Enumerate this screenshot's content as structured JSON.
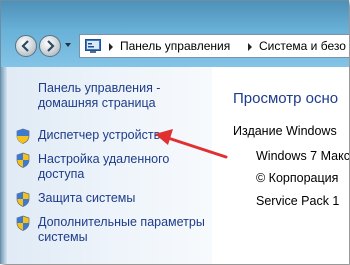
{
  "breadcrumb": [
    "Панель управления",
    "Система и безо"
  ],
  "sidebar": {
    "home_link": [
      "Панель управления -",
      "домашняя страница"
    ],
    "items": [
      {
        "label_lines": [
          "Диспетчер устройств"
        ],
        "icon": "shield-icon"
      },
      {
        "label_lines": [
          "Настройка удаленного",
          "доступа"
        ],
        "icon": "shield-icon"
      },
      {
        "label_lines": [
          "Защита системы"
        ],
        "icon": "shield-icon"
      },
      {
        "label_lines": [
          "Дополнительные параметры",
          "системы"
        ],
        "icon": "shield-icon"
      }
    ]
  },
  "main": {
    "title": "Просмотр осно",
    "edition_heading": "Издание Windows",
    "edition_lines": [
      "Windows 7 Макс",
      "© Корпорация",
      "Service Pack 1"
    ]
  },
  "colors": {
    "link": "#1e3c8a",
    "accent_arrow": "#e03030",
    "aero_bar": "#69b1d8"
  }
}
